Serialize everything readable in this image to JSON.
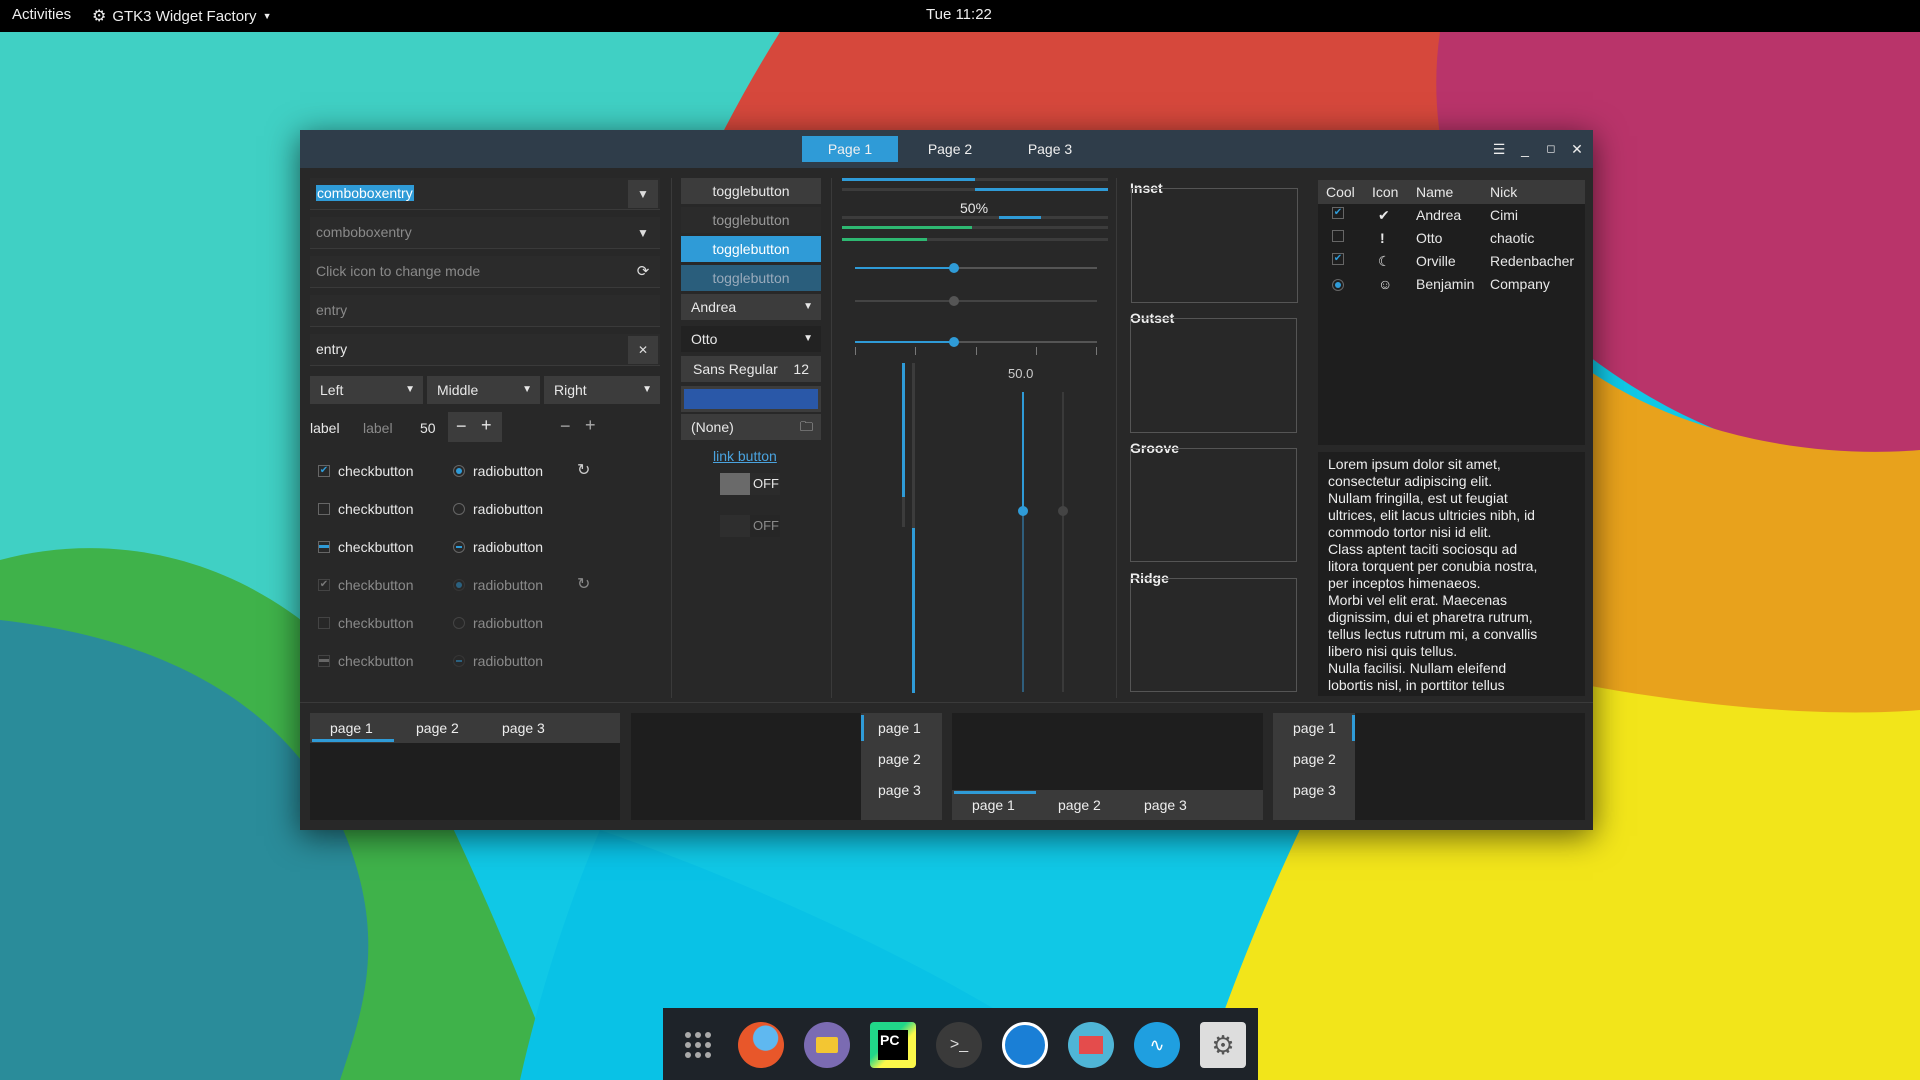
{
  "topbar": {
    "activities": "Activities",
    "app_name": "GTK3 Widget Factory",
    "clock": "Tue 11:22"
  },
  "window": {
    "tabs": [
      "Page 1",
      "Page 2",
      "Page 3"
    ],
    "active_tab": "Page 1",
    "controls": [
      "menu-icon",
      "minimize-icon",
      "maximize-icon",
      "close-icon"
    ]
  },
  "entries": {
    "combo1": "comboboxentry",
    "combo2": "comboboxentry",
    "mode_placeholder": "Click icon to change mode",
    "entry1": "entry",
    "entry2": "entry"
  },
  "combos": {
    "left": "Left",
    "middle": "Middle",
    "right": "Right"
  },
  "spin": {
    "label1": "label",
    "label2": "label",
    "value": "50"
  },
  "checks": [
    {
      "label": "checkbutton",
      "state": "checked"
    },
    {
      "label": "checkbutton",
      "state": "unchecked"
    },
    {
      "label": "checkbutton",
      "state": "mixed"
    },
    {
      "label": "checkbutton",
      "state": "checked-disabled"
    },
    {
      "label": "checkbutton",
      "state": "unchecked-disabled"
    },
    {
      "label": "checkbutton",
      "state": "mixed-disabled"
    }
  ],
  "radios": [
    {
      "label": "radiobutton",
      "state": "checked"
    },
    {
      "label": "radiobutton",
      "state": "unchecked"
    },
    {
      "label": "radiobutton",
      "state": "mixed"
    },
    {
      "label": "radiobutton",
      "state": "checked-disabled"
    },
    {
      "label": "radiobutton",
      "state": "unchecked-disabled"
    },
    {
      "label": "radiobutton",
      "state": "mixed-disabled"
    }
  ],
  "middle": {
    "toggle1": "togglebutton",
    "toggle2": "togglebutton",
    "toggle3": "togglebutton",
    "toggle4": "togglebutton",
    "combo_andrea": "Andrea",
    "combo_otto": "Otto",
    "font_name": "Sans Regular",
    "font_size": "12",
    "file_none": "(None)",
    "link": "link button",
    "switch1": "OFF",
    "switch2": "OFF"
  },
  "scales": {
    "progress_text": "50%",
    "progress_value": 0.5,
    "scale_value": "50.0"
  },
  "frames": [
    "Inset",
    "Outset",
    "Groove",
    "Ridge"
  ],
  "treeview": {
    "columns": [
      "Cool",
      "Icon",
      "Name",
      "Nick"
    ],
    "rows": [
      {
        "cool": "check",
        "icon": "checkmark-circle-icon",
        "name": "Andrea",
        "nick": "Cimi"
      },
      {
        "cool": "empty",
        "icon": "exclamation-icon",
        "name": "Otto",
        "nick": "chaotic"
      },
      {
        "cool": "check",
        "icon": "moon-icon",
        "name": "Orville",
        "nick": "Redenbacher"
      },
      {
        "cool": "radio",
        "icon": "baby-icon",
        "name": "Benjamin",
        "nick": "Company"
      }
    ]
  },
  "textview": {
    "lines": [
      "Lorem ipsum dolor sit amet,",
      "consectetur adipiscing elit.",
      "Nullam fringilla, est ut feugiat",
      "ultrices, elit lacus ultricies nibh, id",
      "commodo tortor nisi id elit.",
      "Class aptent taciti sociosqu ad",
      "litora torquent per conubia nostra,",
      "per inceptos himenaeos.",
      "Morbi vel elit erat. Maecenas",
      "dignissim, dui et pharetra rutrum,",
      "tellus lectus rutrum mi, a convallis",
      "libero nisi quis tellus.",
      "Nulla facilisi. Nullam eleifend",
      "lobortis nisl, in porttitor tellus"
    ]
  },
  "notebooks": {
    "tabs": [
      "page 1",
      "page 2",
      "page 3"
    ]
  },
  "dock": {
    "apps": [
      "app-grid-icon",
      "firefox-icon",
      "files-icon",
      "pycharm-icon",
      "terminal-icon",
      "timeshift-icon",
      "mail-icon",
      "audio-icon",
      "settings-icon"
    ]
  },
  "colors": {
    "accent": "#2f9bd7",
    "headerbar": "#2f3d4a",
    "window_bg": "#282828"
  }
}
